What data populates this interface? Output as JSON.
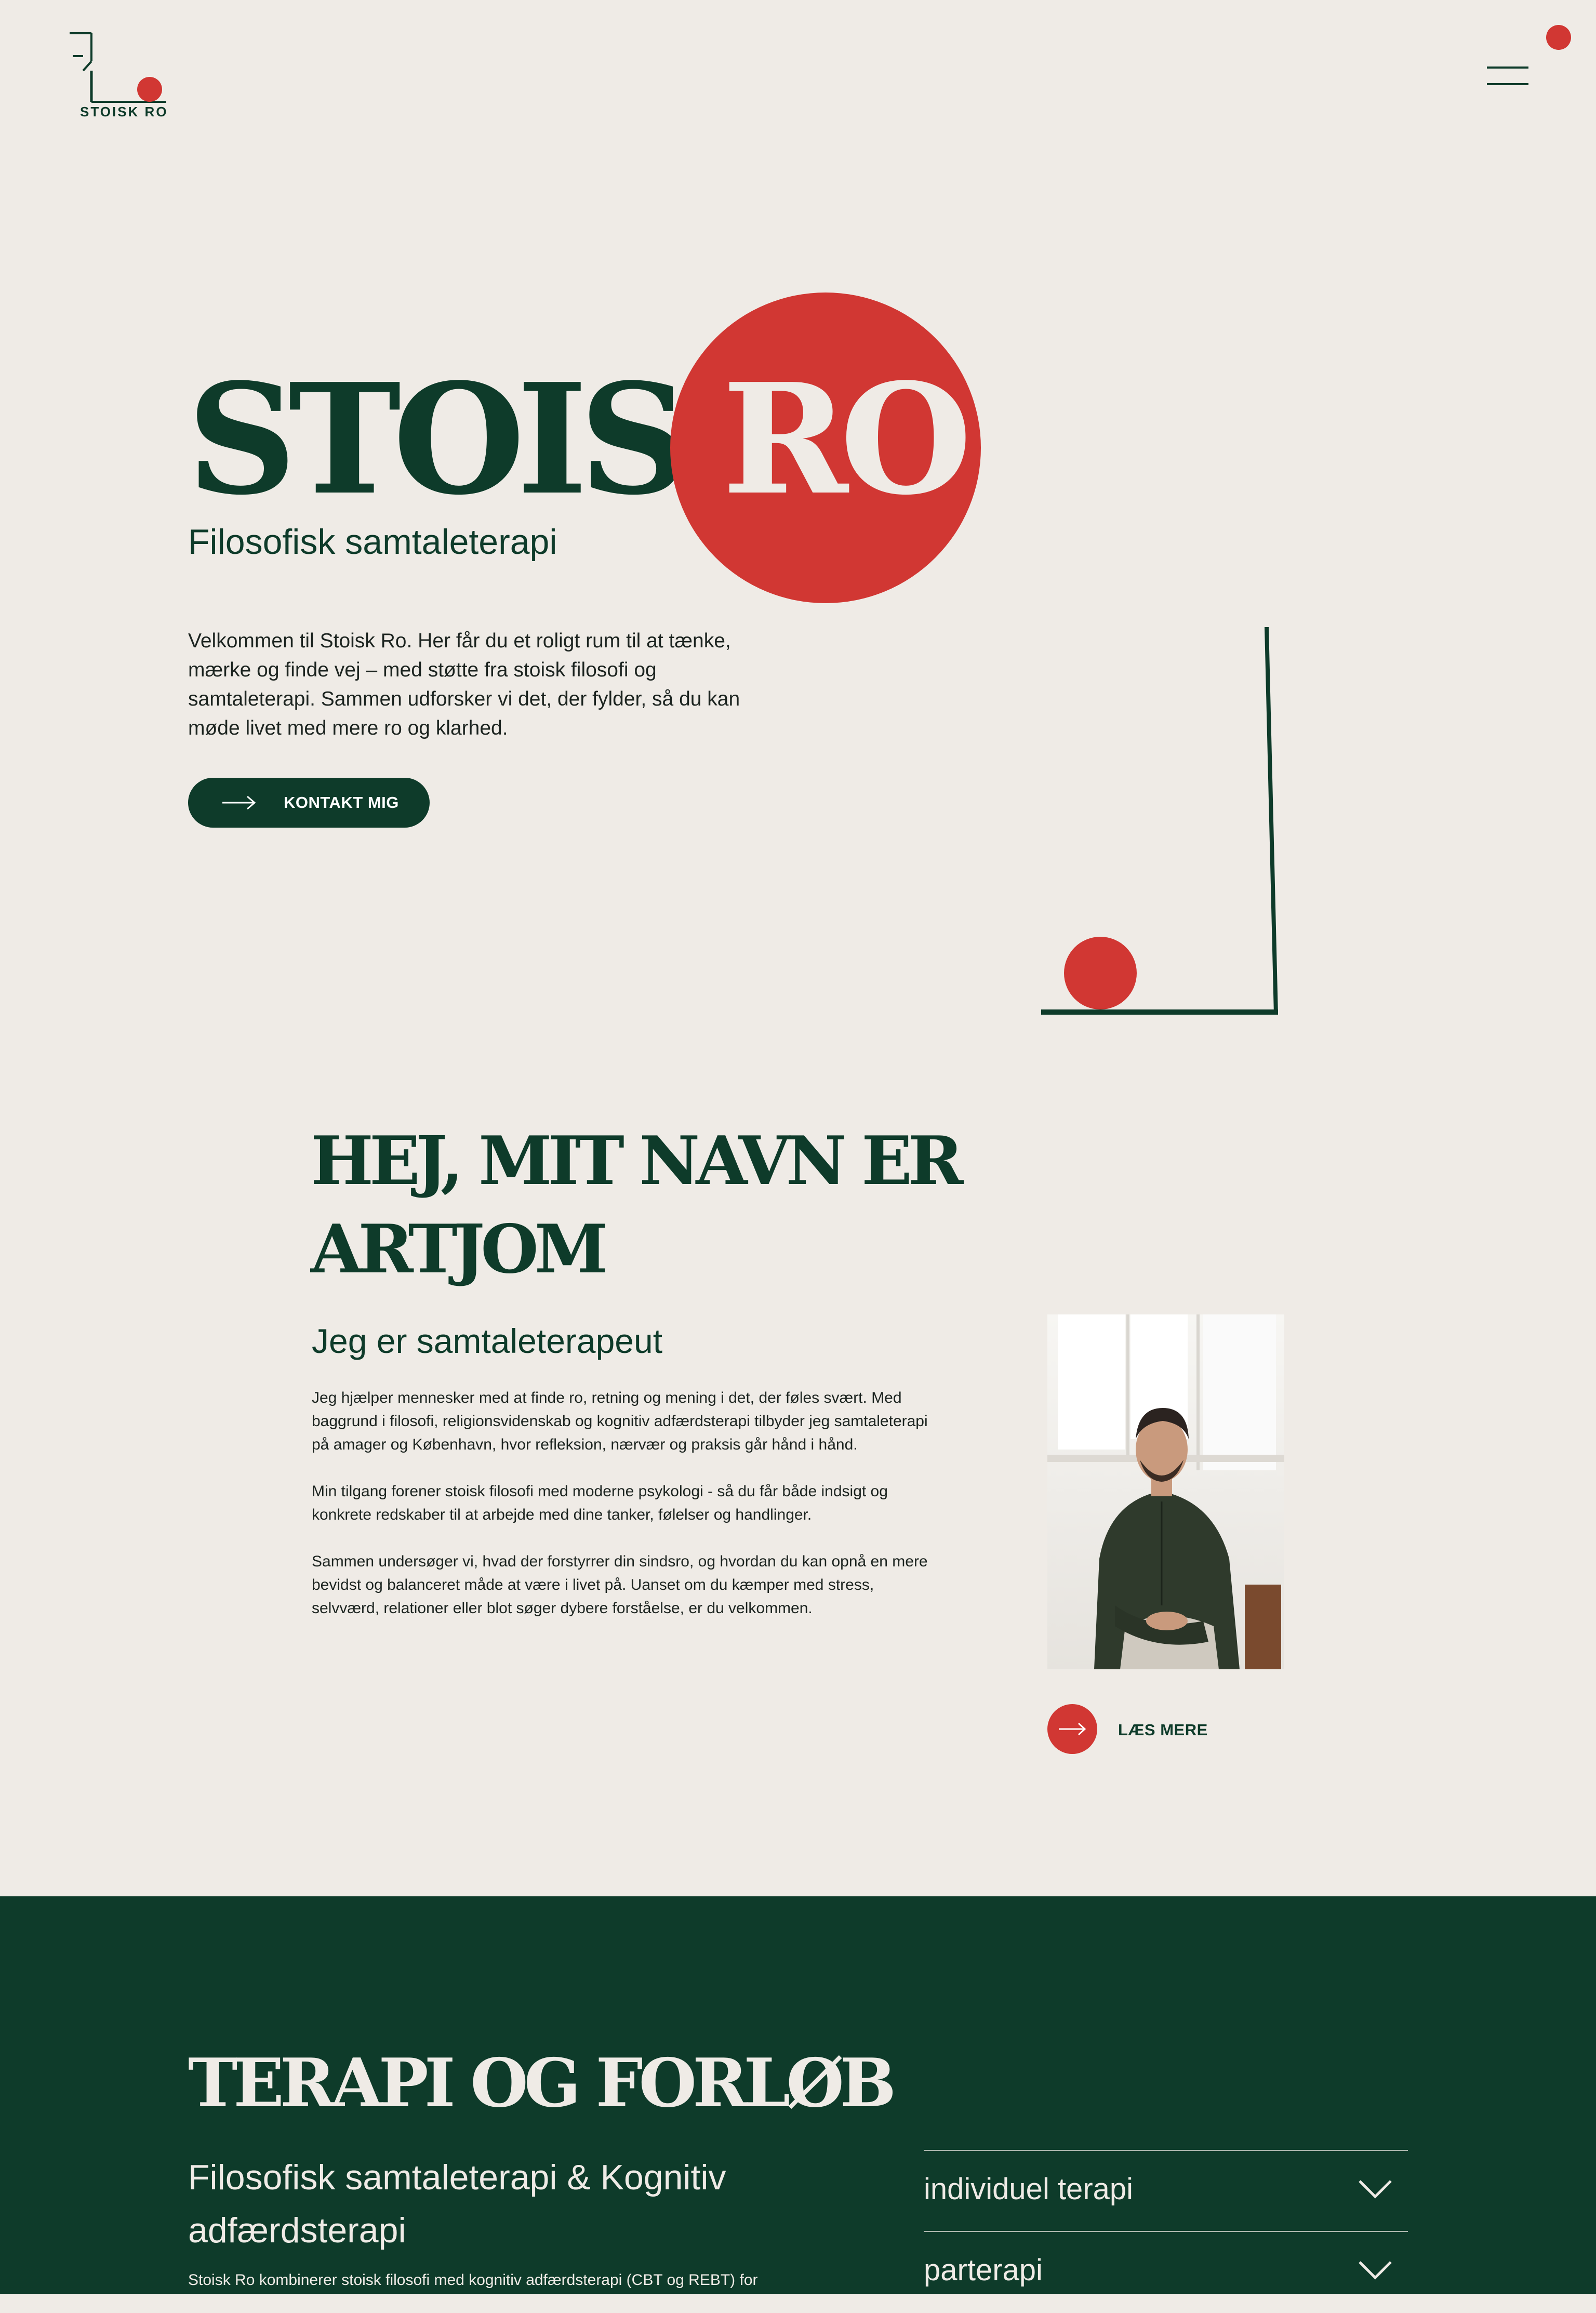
{
  "header": {
    "logo_text": "STOISK RO"
  },
  "hero": {
    "title_part1": "STOISK",
    "title_part2": "RO",
    "subtitle": "Filosofisk samtaleterapi",
    "intro": "Velkommen til Stoisk Ro. Her får du et roligt rum til at tænke, mærke og finde vej – med støtte fra stoisk filosofi og samtaleterapi. Sammen udforsker vi det, der fylder, så du kan møde livet med mere ro og klarhed.",
    "cta_label": "KONTAKT MIG"
  },
  "about": {
    "heading": "HEJ, MIT NAVN ER ARTJOM",
    "subtitle": "Jeg er samtaleterapeut",
    "paragraphs": [
      "Jeg hjælper mennesker med at finde ro, retning og mening i det, der føles svært. Med baggrund i filosofi, religionsvidenskab og kognitiv adfærdsterapi tilbyder jeg samtaleterapi på amager og København, hvor refleksion, nærvær og praksis går hånd i hånd.",
      "Min tilgang forener stoisk filosofi med moderne psykologi - så du får både indsigt og konkrete redskaber til at arbejde med dine tanker, følelser og handlinger.",
      "Sammen undersøger vi, hvad der forstyrrer din sindsro, og hvordan du kan opnå en mere bevidst og balanceret måde at være i livet på. Uanset om du kæmper med stress, selvværd, relationer eller blot søger dybere forståelse, er du velkommen."
    ],
    "read_more_label": "LÆS MERE"
  },
  "therapy": {
    "heading": "TERAPI OG FORLØB",
    "subtitle": "Filosofisk samtaleterapi & Kognitiv adfærdsterapi",
    "text": "Stoisk Ro kombinerer stoisk filosofi med kognitiv adfærdsterapi (CBT og REBT) for",
    "accordion": [
      {
        "label": "individuel terapi"
      },
      {
        "label": "parterapi"
      }
    ]
  },
  "colors": {
    "background": "#efebe6",
    "green": "#0e3b2a",
    "red": "#d13733"
  },
  "icons": [
    "logo-mark",
    "menu-icon",
    "arrow-right-icon",
    "chevron-down-icon"
  ]
}
